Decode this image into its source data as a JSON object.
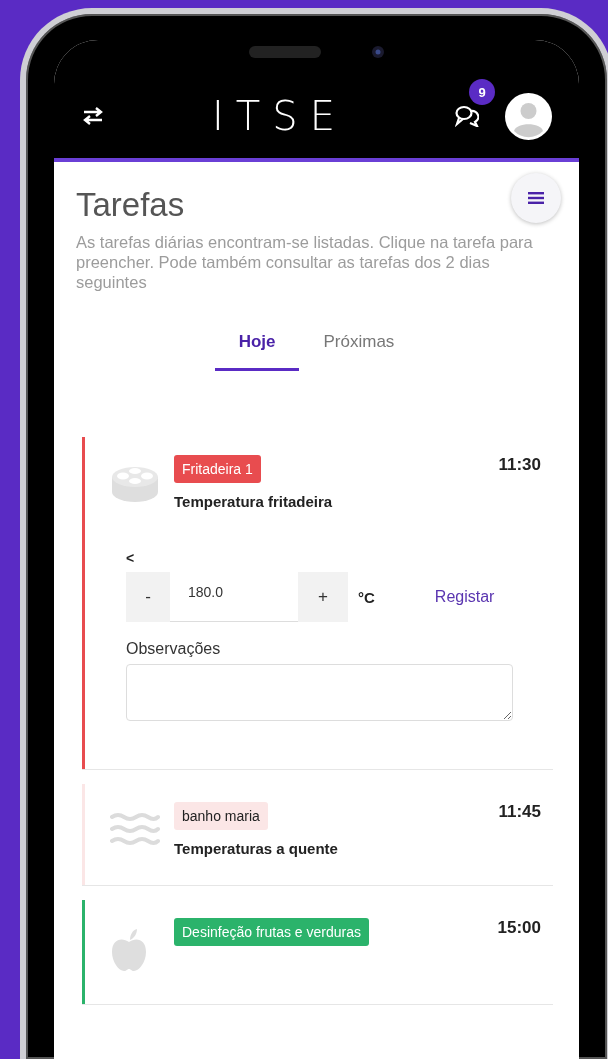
{
  "header": {
    "logo": "ITSE",
    "notification_count": "9"
  },
  "page": {
    "title": "Tarefas",
    "description": "As tarefas diárias encontram-se listadas. Clique na tarefa para preencher. Pode também consultar as tarefas dos 2 dias seguintes"
  },
  "tabs": [
    {
      "label": "Hoje",
      "selected": true
    },
    {
      "label": "Próximas",
      "selected": false
    }
  ],
  "tasks": [
    {
      "tag": "Fritadeira 1",
      "color": "#e84c4f",
      "title": "Temperatura fritadeira",
      "time": "11:30",
      "form": {
        "comparator": "<",
        "decrement": "-",
        "value": "180.0",
        "increment": "+",
        "unit": "°C",
        "submit": "Registar",
        "notes_label": "Observações"
      }
    },
    {
      "tag": "banho maria",
      "color": "#fbe6e6",
      "title": "Temperaturas a quente",
      "time": "11:45"
    },
    {
      "tag": "Desinfeção frutas e verduras",
      "color": "#2bb36b",
      "time": "15:00"
    }
  ]
}
